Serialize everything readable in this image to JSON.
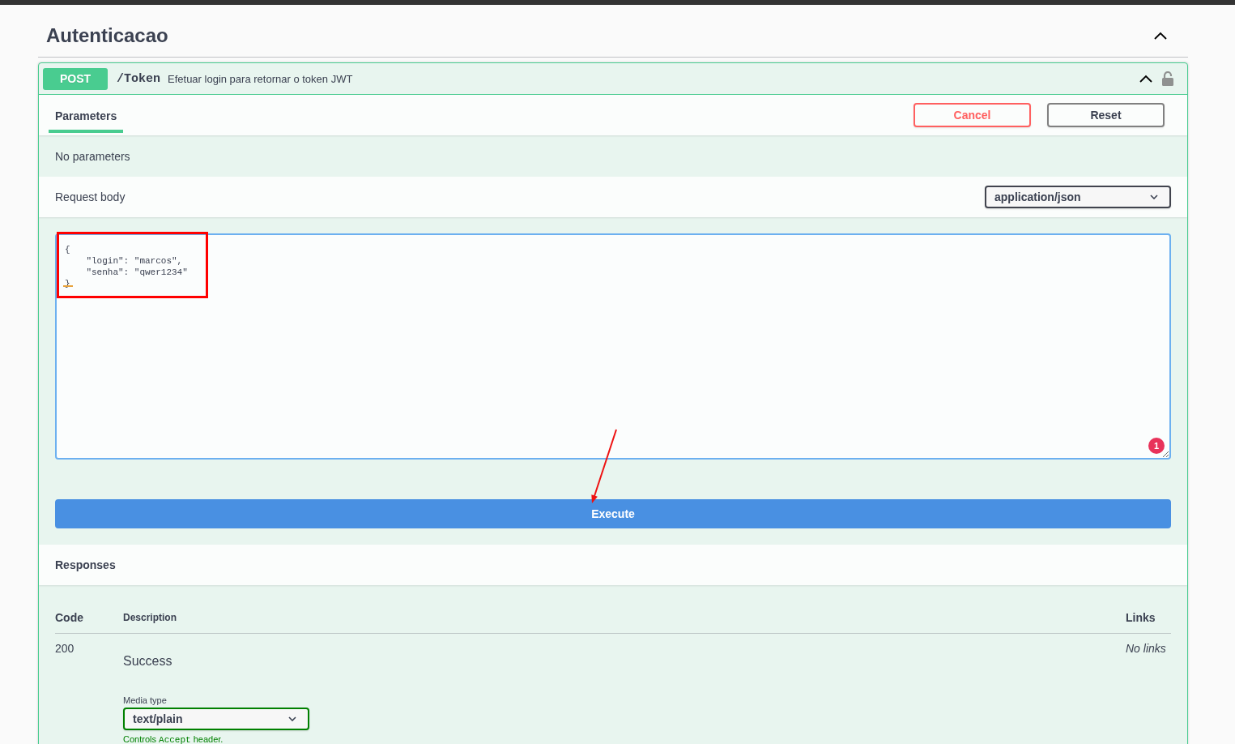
{
  "section": {
    "title": "Autenticacao",
    "expanded": true
  },
  "operation": {
    "method": "POST",
    "path": "/Token",
    "description": "Efetuar login para retornar o token JWT",
    "expanded": true,
    "locked": false
  },
  "parameters": {
    "tabs": [
      {
        "label": "Parameters",
        "selected": true
      }
    ],
    "buttons": [
      {
        "label": "Cancel",
        "kind": "cancel"
      },
      {
        "label": "Reset",
        "kind": "reset"
      }
    ],
    "empty_message": "No parameters"
  },
  "request_body": {
    "label": "Request body",
    "content_type": "application/json",
    "lines": [
      "{",
      "    \"login\": \"marcos\",",
      "    \"senha\": \"qwer1234\"",
      "}"
    ],
    "badge": "1"
  },
  "execute": {
    "label": "Execute"
  },
  "responses": {
    "title": "Responses",
    "columns": [
      "Code",
      "Description",
      "Links"
    ],
    "rows": [
      {
        "code": "200",
        "description": "Success",
        "links": "No links",
        "media_type_label": "Media type",
        "media_type": "text/plain",
        "hint": {
          "before": "Controls",
          "code": "Accept",
          "after": "header."
        }
      }
    ]
  }
}
